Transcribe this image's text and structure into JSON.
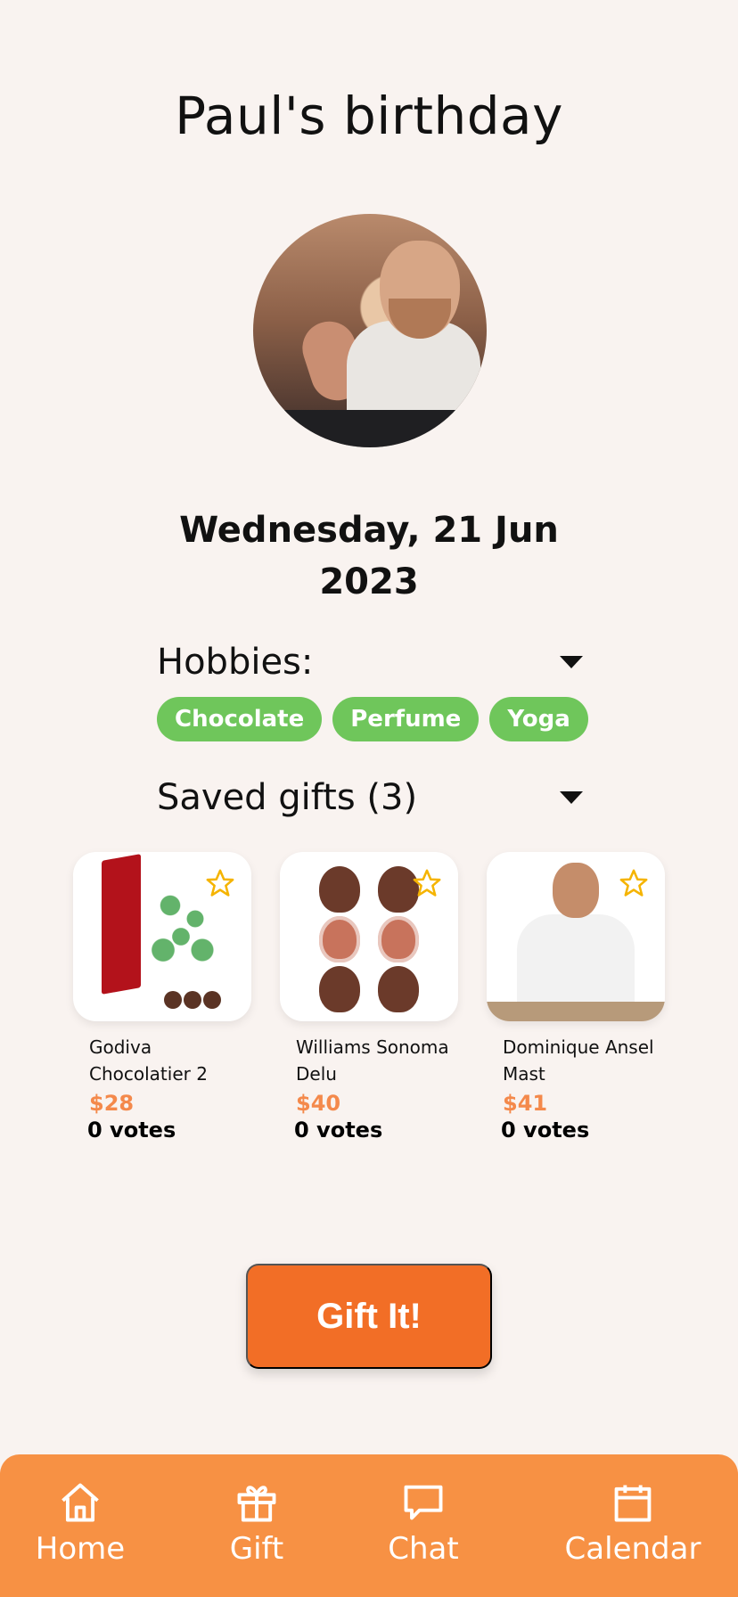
{
  "event": {
    "title": "Paul's birthday",
    "date_line1": "Wednesday, 21 Jun",
    "date_line2": "2023"
  },
  "hobbies": {
    "label": "Hobbies:",
    "chips": [
      "Chocolate",
      "Perfume",
      "Yoga"
    ]
  },
  "saved_gifts": {
    "label": "Saved gifts (3)",
    "items": [
      {
        "name_line1": "Godiva",
        "name_line2": "Chocolatier 2",
        "price": "$28",
        "votes": "0 votes",
        "starred": false
      },
      {
        "name_line1": "Williams Sonoma",
        "name_line2": "Delu",
        "price": "$40",
        "votes": "0 votes",
        "starred": false
      },
      {
        "name_line1": "Dominique Ansel",
        "name_line2": "Mast",
        "price": "$41",
        "votes": "0 votes",
        "starred": false
      }
    ]
  },
  "cta": {
    "label": "Gift It!"
  },
  "tabbar": {
    "items": [
      {
        "label": "Home",
        "icon": "home-icon"
      },
      {
        "label": "Gift",
        "icon": "gift-icon"
      },
      {
        "label": "Chat",
        "icon": "chat-icon"
      },
      {
        "label": "Calendar",
        "icon": "calendar-icon"
      }
    ]
  },
  "colors": {
    "background": "#f9f3f0",
    "chip": "#6fc65b",
    "price": "#f4894b",
    "cta": "#f26e26",
    "tabbar": "#f79144",
    "star": "#f5b400"
  }
}
